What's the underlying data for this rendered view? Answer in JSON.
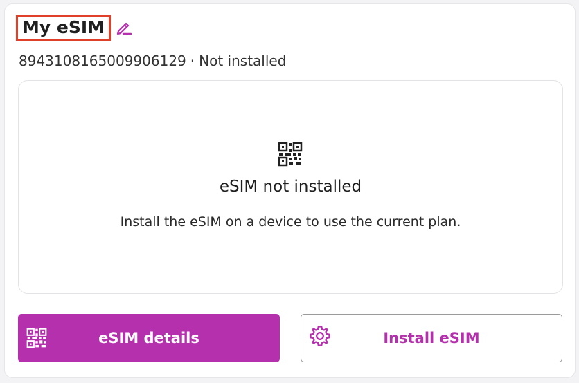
{
  "header": {
    "title": "My eSIM",
    "edit_icon": "pencil-edit-icon",
    "iccid": "8943108165009906129",
    "separator": "·",
    "install_state": "Not installed"
  },
  "status": {
    "icon": "qr-code-icon",
    "title": "eSIM not installed",
    "description": "Install the eSIM on a device to use the current plan."
  },
  "actions": {
    "details_label": "eSIM details",
    "details_icon": "qr-code-icon",
    "install_label": "Install eSIM",
    "install_icon": "gear-icon"
  },
  "colors": {
    "accent": "#b530ad",
    "highlight_border": "#e0402a"
  }
}
